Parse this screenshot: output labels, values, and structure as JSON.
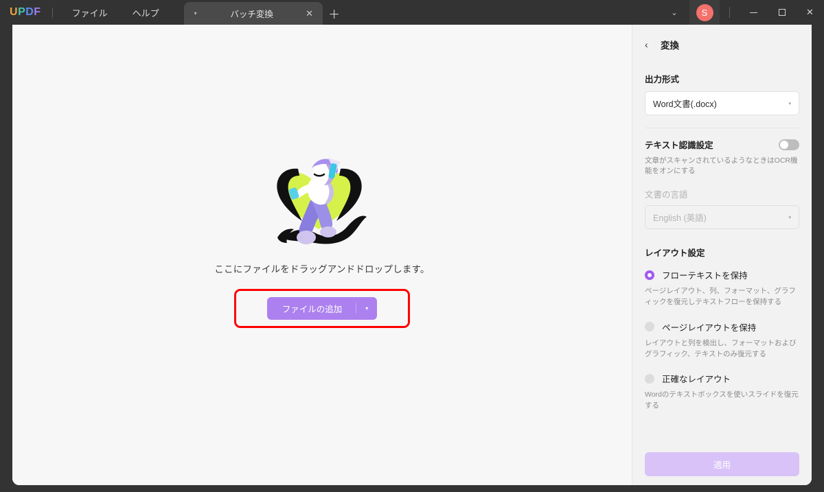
{
  "titlebar": {
    "logo_letters": [
      "U",
      "P",
      "D",
      "F"
    ],
    "menus": [
      {
        "label": "ファイル",
        "name": "menu-file"
      },
      {
        "label": "ヘルプ",
        "name": "menu-help"
      }
    ],
    "tab": {
      "title": "バッチ変換",
      "caret_icon": "▾",
      "close_icon": "✕"
    },
    "new_tab_icon": "＋",
    "chevron_icon": "⌄",
    "avatar_initial": "S",
    "close_icon": "✕"
  },
  "canvas": {
    "drop_text": "ここにファイルをドラッグアンドドロップします。",
    "add_button_label": "ファイルの追加",
    "add_button_caret": "▾",
    "highlight_color": "#ff0000",
    "button_color": "#ad80ef"
  },
  "panel": {
    "back_icon": "‹",
    "title": "変換",
    "output_format": {
      "label": "出力形式",
      "value": "Word文書(.docx)",
      "caret": "▾"
    },
    "ocr": {
      "label": "テキスト認識設定",
      "enabled": false,
      "hint": "文章がスキャンされているようなときはOCR機能をオンにする",
      "language_label": "文書の言語",
      "language_value": "English (英語)",
      "caret": "▾"
    },
    "layout": {
      "label": "レイアウト設定",
      "options": [
        {
          "label": "フローテキストを保持",
          "selected": true,
          "hint": "ページレイアウト、列、フォーマット、グラフィックを復元しテキストフローを保持する"
        },
        {
          "label": "ページレイアウトを保持",
          "selected": false,
          "hint": "レイアウトと列を検出し、フォーマットおよびグラフィック、テキストのみ復元する"
        },
        {
          "label": "正確なレイアウト",
          "selected": false,
          "hint": "Wordのテキストボックスを使いスライドを復元する"
        }
      ],
      "accent_color": "#a259f0"
    },
    "apply_label": "適用"
  }
}
